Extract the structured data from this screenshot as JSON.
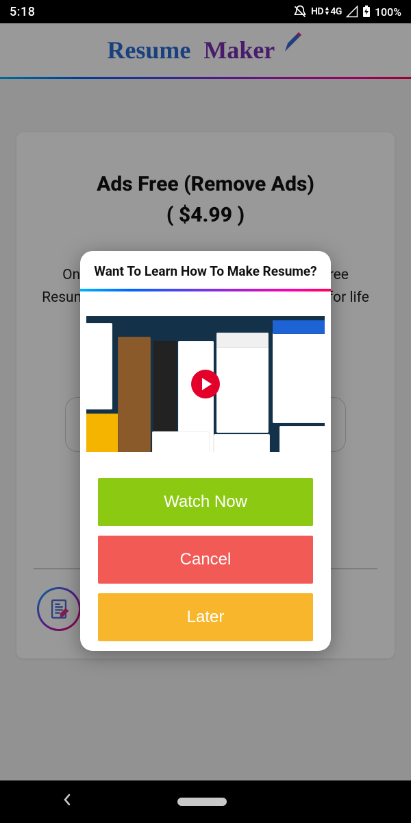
{
  "status": {
    "time": "5:18",
    "hd": "HD",
    "net": "4G",
    "battery": "100%"
  },
  "header": {
    "logo_a": "Resume",
    "logo_b": "Maker"
  },
  "card": {
    "title": "Ads Free (Remove Ads)",
    "price": "( $4.99 )",
    "desc": "On time payment for Life time, Enjoy ads free Resume Maker App with remove all type ads for life time where only single time purchase."
  },
  "brand": {
    "name": "Resume Maker"
  },
  "dialog": {
    "title": "Want To Learn How To Make Resume?",
    "watch": "Watch Now",
    "cancel": "Cancel",
    "later": "Later"
  }
}
